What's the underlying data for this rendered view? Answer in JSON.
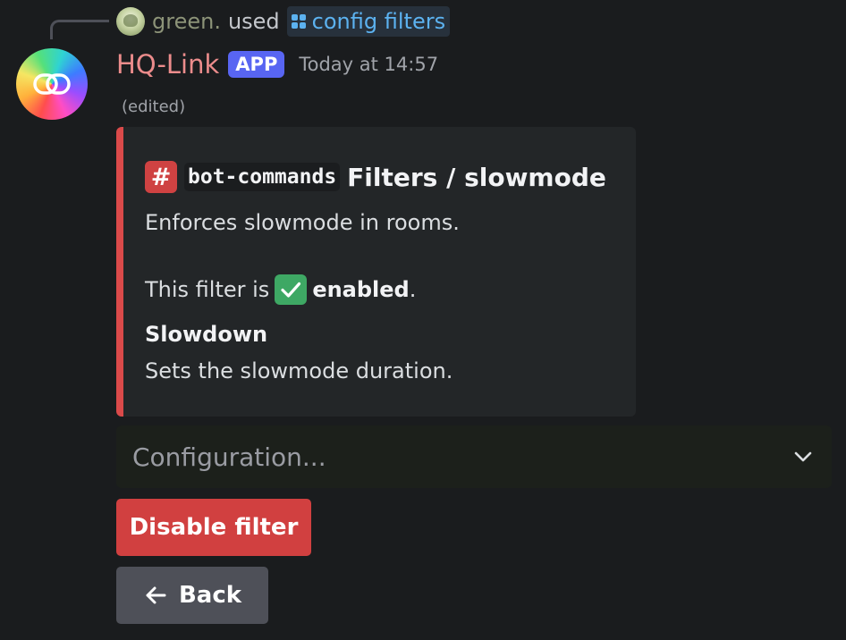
{
  "reply": {
    "username": "green.",
    "used_text": "used",
    "command": "config filters"
  },
  "message": {
    "author": "HQ-Link",
    "badge": "APP",
    "timestamp": "Today at 14:57",
    "edited": "(edited)"
  },
  "embed": {
    "accent_color": "#da4a4a",
    "channel_symbol": "#",
    "channel_name": "bot-commands",
    "title": "Filters / slowmode",
    "description": "Enforces slowmode in rooms.",
    "status_prefix": "This filter is",
    "status_word": "enabled",
    "status_suffix": ".",
    "field_name": "Slowdown",
    "field_value": "Sets the slowmode duration."
  },
  "select": {
    "placeholder": "Configuration..."
  },
  "buttons": {
    "disable_label": "Disable filter",
    "back_label": "Back"
  }
}
